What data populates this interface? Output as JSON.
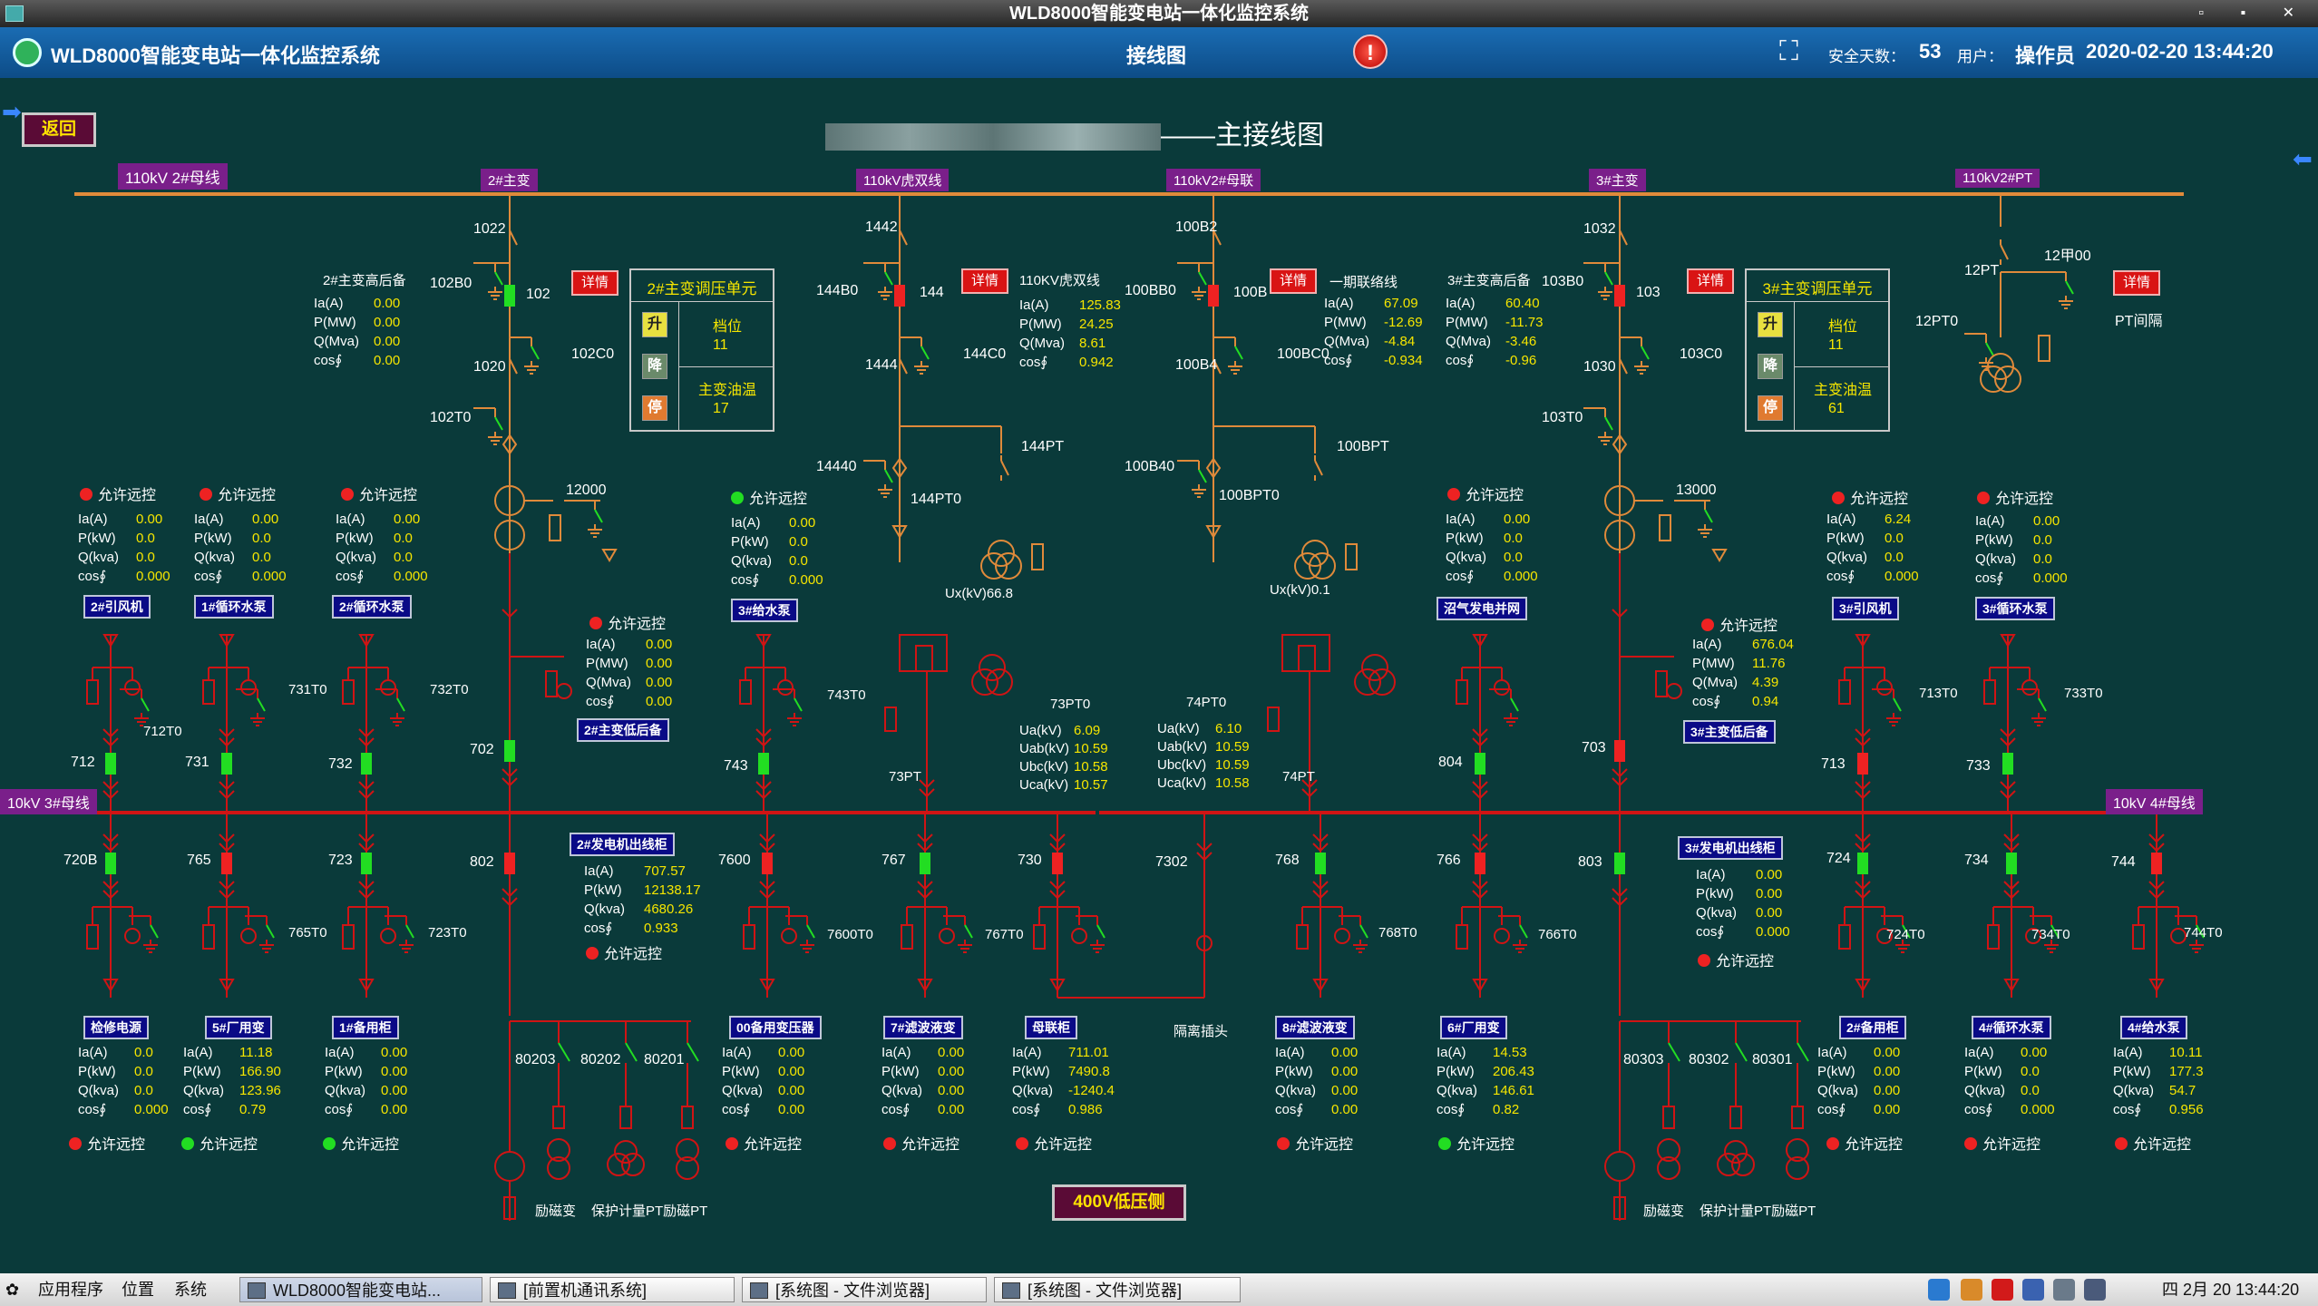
{
  "window": {
    "title": "WLD8000智能变电站一体化监控系统",
    "buttons": "▫ ▪ ✕"
  },
  "header": {
    "app_title": "WLD8000智能变电站一体化监控系统",
    "view_name": "接线图",
    "alarm_symbol": "!",
    "fullscreen_symbol": "⛶",
    "safe_days_label": "安全天数：",
    "safe_days": "53",
    "user_label": "用户：",
    "user": "操作员",
    "datetime": "2020-02-20 13:44:20"
  },
  "nav": {
    "back": "返回",
    "left_arrow": "➡",
    "right_arrow": "⬅"
  },
  "diagram": {
    "title_suffix": "——主接线图",
    "bus_110": "110kV 2#母线",
    "bus_10_left": "10kV 3#母线",
    "bus_10_right": "10kV 4#母线",
    "low_voltage_button": "400V低压侧",
    "detail_label": "详情"
  },
  "bays110": [
    {
      "tag": "2#主变",
      "labels": [
        "1022",
        "102B0",
        "102",
        "1020",
        "102C0",
        "102T0"
      ]
    },
    {
      "tag": "110kV虎双线",
      "labels": [
        "1442",
        "144B0",
        "144",
        "1444",
        "144C0",
        "14440",
        "144PT",
        "144PT0"
      ]
    },
    {
      "tag": "110kV2#母联",
      "labels": [
        "100B2",
        "100BB0",
        "100B",
        "100B4",
        "100BC0",
        "100B40",
        "100BPT",
        "100BPT0"
      ]
    },
    {
      "tag": "3#主变",
      "labels": [
        "1032",
        "103B0",
        "103",
        "1030",
        "103C0",
        "103T0"
      ]
    },
    {
      "tag": "110kV2#PT",
      "labels": [
        "12PT",
        "12甲00",
        "12PT0",
        "PT间隔"
      ]
    }
  ],
  "meas110": [
    {
      "title": "2#主变高后备",
      "rows": [
        [
          "Ia(A)",
          "0.00"
        ],
        [
          "P(MW)",
          "0.00"
        ],
        [
          "Q(Mva)",
          "0.00"
        ],
        [
          "cos∮",
          "0.00"
        ]
      ]
    },
    {
      "title": "110KV虎双线",
      "rows": [
        [
          "Ia(A)",
          "125.83"
        ],
        [
          "P(MW)",
          "24.25"
        ],
        [
          "Q(Mva)",
          "8.61"
        ],
        [
          "cos∮",
          "0.942"
        ]
      ]
    },
    {
      "title": "一期联络线",
      "rows": [
        [
          "Ia(A)",
          "67.09"
        ],
        [
          "P(MW)",
          "-12.69"
        ],
        [
          "Q(Mva)",
          "-4.84"
        ],
        [
          "cos∮",
          "-0.934"
        ]
      ]
    },
    {
      "title": "3#主变高后备",
      "rows": [
        [
          "Ia(A)",
          "60.40"
        ],
        [
          "P(MW)",
          "-11.73"
        ],
        [
          "Q(Mva)",
          "-3.46"
        ],
        [
          "cos∮",
          "-0.96"
        ]
      ]
    }
  ],
  "tapUnits": [
    {
      "title": "2#主变调压单元",
      "up": "升",
      "down": "降",
      "stop": "停",
      "gear_label": "档位",
      "gear": "11",
      "oil_label": "主变油温",
      "oil": "17"
    },
    {
      "title": "3#主变调压单元",
      "up": "升",
      "down": "降",
      "stop": "停",
      "gear_label": "档位",
      "gear": "11",
      "oil_label": "主变油温",
      "oil": "61"
    }
  ],
  "transformers": {
    "t2": "12000",
    "t3": "13000",
    "ux144": "Ux(kV)66.8",
    "ux100": "Ux(kV)0.1"
  },
  "remote_label": "允许远控",
  "upperFeeders": [
    {
      "btn": "2#引风机",
      "bay": "712",
      "ground": "712T0",
      "status": "red",
      "rows": [
        [
          "Ia(A)",
          "0.00"
        ],
        [
          "P(kW)",
          "0.0"
        ],
        [
          "Q(kva)",
          "0.0"
        ],
        [
          "cos∮",
          "0.000"
        ]
      ]
    },
    {
      "btn": "1#循环水泵",
      "bay": "731",
      "ground": "731T0",
      "status": "red",
      "rows": [
        [
          "Ia(A)",
          "0.00"
        ],
        [
          "P(kW)",
          "0.0"
        ],
        [
          "Q(kva)",
          "0.0"
        ],
        [
          "cos∮",
          "0.000"
        ]
      ]
    },
    {
      "btn": "2#循环水泵",
      "bay": "732",
      "ground": "732T0",
      "status": "red",
      "rows": [
        [
          "Ia(A)",
          "0.00"
        ],
        [
          "P(kW)",
          "0.0"
        ],
        [
          "Q(kva)",
          "0.0"
        ],
        [
          "cos∮",
          "0.000"
        ]
      ]
    },
    {
      "btn": "3#给水泵",
      "bay": "743",
      "ground": "743T0",
      "status": "green",
      "rows": [
        [
          "Ia(A)",
          "0.00"
        ],
        [
          "P(kW)",
          "0.0"
        ],
        [
          "Q(kva)",
          "0.0"
        ],
        [
          "cos∮",
          "0.000"
        ]
      ]
    },
    {
      "btn": "沼气发电并网",
      "bay": "804",
      "ground": "",
      "status": "red",
      "rows": [
        [
          "Ia(A)",
          "0.00"
        ],
        [
          "P(kW)",
          "0.0"
        ],
        [
          "Q(kva)",
          "0.0"
        ],
        [
          "cos∮",
          "0.000"
        ]
      ]
    },
    {
      "btn": "3#引风机",
      "bay": "713",
      "ground": "713T0",
      "status": "red",
      "rows": [
        [
          "Ia(A)",
          "6.24"
        ],
        [
          "P(kW)",
          "0.0"
        ],
        [
          "Q(kva)",
          "0.0"
        ],
        [
          "cos∮",
          "0.000"
        ]
      ]
    },
    {
      "btn": "3#循环水泵",
      "bay": "733",
      "ground": "733T0",
      "status": "red",
      "rows": [
        [
          "Ia(A)",
          "0.00"
        ],
        [
          "P(kW)",
          "0.0"
        ],
        [
          "Q(kva)",
          "0.0"
        ],
        [
          "cos∮",
          "0.000"
        ]
      ]
    }
  ],
  "lowSide": [
    {
      "btn": "2#主变低后备",
      "bay": "702",
      "status": "red",
      "rows": [
        [
          "Ia(A)",
          "0.00"
        ],
        [
          "P(MW)",
          "0.00"
        ],
        [
          "Q(Mva)",
          "0.00"
        ],
        [
          "cos∮",
          "0.00"
        ]
      ]
    },
    {
      "btn": "3#主变低后备",
      "bay": "703",
      "status": "red",
      "rows": [
        [
          "Ia(A)",
          "676.04"
        ],
        [
          "P(MW)",
          "11.76"
        ],
        [
          "Q(Mva)",
          "4.39"
        ],
        [
          "cos∮",
          "0.94"
        ]
      ]
    }
  ],
  "ptBays": [
    {
      "top": "73PT0",
      "bottom": "73PT",
      "rows": [
        [
          "Ua(kV)",
          "6.09"
        ],
        [
          "Uab(kV)",
          "10.59"
        ],
        [
          "Ubc(kV)",
          "10.58"
        ],
        [
          "Uca(kV)",
          "10.57"
        ]
      ]
    },
    {
      "top": "74PT0",
      "bottom": "74PT",
      "rows": [
        [
          "Ua(kV)",
          "6.10"
        ],
        [
          "Uab(kV)",
          "10.59"
        ],
        [
          "Ubc(kV)",
          "10.59"
        ],
        [
          "Uca(kV)",
          "10.58"
        ]
      ]
    }
  ],
  "generators": [
    {
      "btn": "2#发电机出线柜",
      "bay": "802",
      "rows": [
        [
          "Ia(A)",
          "707.57"
        ],
        [
          "P(kW)",
          "12138.17"
        ],
        [
          "Q(kva)",
          "4680.26"
        ],
        [
          "cos∮",
          "0.933"
        ]
      ],
      "status": "red",
      "sub": [
        "80203",
        "80202",
        "80201"
      ],
      "bottom": [
        "励磁变",
        "保护计量PT励磁PT"
      ]
    },
    {
      "btn": "3#发电机出线柜",
      "bay": "803",
      "rows": [
        [
          "Ia(A)",
          "0.00"
        ],
        [
          "P(kW)",
          "0.00"
        ],
        [
          "Q(kva)",
          "0.00"
        ],
        [
          "cos∮",
          "0.000"
        ]
      ],
      "status": "red",
      "sub": [
        "80303",
        "80302",
        "80301"
      ],
      "bottom": [
        "励磁变",
        "保护计量PT励磁PT"
      ]
    }
  ],
  "lowerBays": [
    "720B",
    "765",
    "723",
    "7600",
    "767",
    "730",
    "7302",
    "768",
    "766",
    "724",
    "734",
    "744"
  ],
  "lowerGrounds": [
    "765T0",
    "723T0",
    "7600T0",
    "767T0",
    "768T0",
    "766T0",
    "724T0",
    "734T0",
    "744T0"
  ],
  "isolation_label": "隔离插头",
  "lowerFeeders": [
    {
      "btn": "检修电源",
      "status": "red",
      "rows": [
        [
          "Ia(A)",
          "0.0"
        ],
        [
          "P(kW)",
          "0.0"
        ],
        [
          "Q(kva)",
          "0.0"
        ],
        [
          "cos∮",
          "0.000"
        ]
      ]
    },
    {
      "btn": "5#厂用变",
      "status": "green",
      "rows": [
        [
          "Ia(A)",
          "11.18"
        ],
        [
          "P(kW)",
          "166.90"
        ],
        [
          "Q(kva)",
          "123.96"
        ],
        [
          "cos∮",
          "0.79"
        ]
      ]
    },
    {
      "btn": "1#备用柜",
      "status": "green",
      "rows": [
        [
          "Ia(A)",
          "0.00"
        ],
        [
          "P(kW)",
          "0.00"
        ],
        [
          "Q(kva)",
          "0.00"
        ],
        [
          "cos∮",
          "0.00"
        ]
      ]
    },
    {
      "btn": "00备用变压器",
      "status": "red",
      "rows": [
        [
          "Ia(A)",
          "0.00"
        ],
        [
          "P(kW)",
          "0.00"
        ],
        [
          "Q(kva)",
          "0.00"
        ],
        [
          "cos∮",
          "0.00"
        ]
      ]
    },
    {
      "btn": "7#滤波液变",
      "status": "red",
      "rows": [
        [
          "Ia(A)",
          "0.00"
        ],
        [
          "P(kW)",
          "0.00"
        ],
        [
          "Q(kva)",
          "0.00"
        ],
        [
          "cos∮",
          "0.00"
        ]
      ]
    },
    {
      "btn": "母联柜",
      "status": "red",
      "rows": [
        [
          "Ia(A)",
          "711.01"
        ],
        [
          "P(kW)",
          "7490.8"
        ],
        [
          "Q(kva)",
          "-1240.4"
        ],
        [
          "cos∮",
          "0.986"
        ]
      ]
    },
    {
      "btn": "8#滤波液变",
      "status": "red",
      "rows": [
        [
          "Ia(A)",
          "0.00"
        ],
        [
          "P(kW)",
          "0.00"
        ],
        [
          "Q(kva)",
          "0.00"
        ],
        [
          "cos∮",
          "0.00"
        ]
      ]
    },
    {
      "btn": "6#厂用变",
      "status": "green",
      "rows": [
        [
          "Ia(A)",
          "14.53"
        ],
        [
          "P(kW)",
          "206.43"
        ],
        [
          "Q(kva)",
          "146.61"
        ],
        [
          "cos∮",
          "0.82"
        ]
      ]
    },
    {
      "btn": "2#备用柜",
      "status": "red",
      "rows": [
        [
          "Ia(A)",
          "0.00"
        ],
        [
          "P(kW)",
          "0.00"
        ],
        [
          "Q(kva)",
          "0.00"
        ],
        [
          "cos∮",
          "0.00"
        ]
      ]
    },
    {
      "btn": "4#循环水泵",
      "status": "red",
      "rows": [
        [
          "Ia(A)",
          "0.00"
        ],
        [
          "P(kW)",
          "0.0"
        ],
        [
          "Q(kva)",
          "0.0"
        ],
        [
          "cos∮",
          "0.000"
        ]
      ]
    },
    {
      "btn": "4#给水泵",
      "status": "red",
      "rows": [
        [
          "Ia(A)",
          "10.11"
        ],
        [
          "P(kW)",
          "177.3"
        ],
        [
          "Q(kva)",
          "54.7"
        ],
        [
          "cos∮",
          "0.956"
        ]
      ]
    }
  ],
  "taskbar": {
    "apps": "应用程序",
    "places": "位置",
    "system": "系统",
    "tasks": [
      "WLD8000智能变电站...",
      "[前置机通讯系统]",
      "[系统图 - 文件浏览器]",
      "[系统图 - 文件浏览器]"
    ],
    "clock": "四 2月 20 13:44:20"
  },
  "colors": {
    "bus_110": "#e08a3a",
    "bus_10": "#d01414",
    "closed": "#22dd22",
    "open": "#ee2222",
    "value": "#f6e600"
  }
}
